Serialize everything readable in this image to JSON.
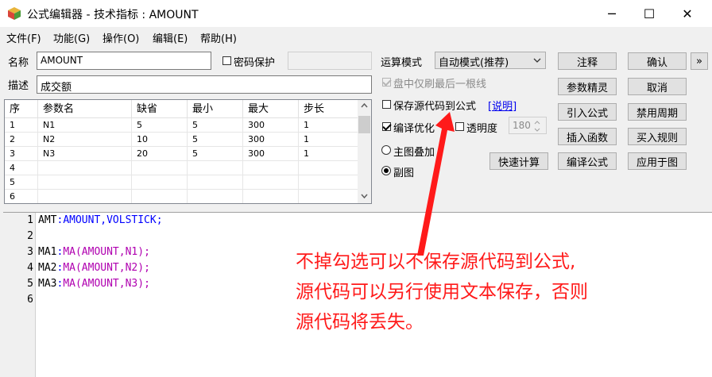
{
  "window": {
    "title": "公式编辑器 - 技术指标 : AMOUNT",
    "minimize": "─",
    "maximize": "☐",
    "close": "✕"
  },
  "menu": [
    "文件(F)",
    "功能(G)",
    "操作(O)",
    "编辑(E)",
    "帮助(H)"
  ],
  "form": {
    "name_label": "名称",
    "name_value": "AMOUNT",
    "password_label": "密码保护",
    "desc_label": "描述",
    "desc_value": "成交额"
  },
  "params": {
    "headers": [
      "序",
      "参数名",
      "缺省",
      "最小",
      "最大",
      "步长"
    ],
    "rows": [
      [
        "1",
        "N1",
        "5",
        "5",
        "300",
        "1"
      ],
      [
        "2",
        "N2",
        "10",
        "5",
        "300",
        "1"
      ],
      [
        "3",
        "N3",
        "20",
        "5",
        "300",
        "1"
      ],
      [
        "4",
        "",
        "",
        "",
        "",
        ""
      ],
      [
        "5",
        "",
        "",
        "",
        "",
        ""
      ],
      [
        "6",
        "",
        "",
        "",
        "",
        ""
      ]
    ]
  },
  "options": {
    "run_mode_label": "运算模式",
    "run_mode_value": "自动模式(推荐)",
    "last_bar_label": "盘中仅刷最后一根线",
    "save_source_label": "保存源代码到公式",
    "explain_link": "[说明]",
    "compile_opt_label": "编译优化",
    "transparency_label": "透明度",
    "transparency_value": "180",
    "main_overlay_label": "主图叠加",
    "sub_chart_label": "副图",
    "quick_calc": "快速计算"
  },
  "buttons": {
    "annotate": "注释",
    "confirm": "确认",
    "more": "»",
    "param_wizard": "参数精灵",
    "cancel": "取消",
    "import": "引入公式",
    "disable_period": "禁用周期",
    "insert_func": "插入函数",
    "buy_rule": "买入规则",
    "compile": "编译公式",
    "apply_chart": "应用于图"
  },
  "editor": {
    "lines": [
      {
        "n": "1",
        "name": "AMT",
        "sep": ":",
        "expr_kw": "AMOUNT,VOLSTICK",
        "fn": "",
        "end": ";"
      },
      {
        "n": "2",
        "name": "",
        "sep": "",
        "expr_kw": "",
        "fn": "",
        "end": ""
      },
      {
        "n": "3",
        "name": "MA1",
        "sep": ":",
        "expr_kw": "",
        "fn": "MA(AMOUNT,N1)",
        "end": ";"
      },
      {
        "n": "4",
        "name": "MA2",
        "sep": ":",
        "expr_kw": "",
        "fn": "MA(AMOUNT,N2)",
        "end": ";"
      },
      {
        "n": "5",
        "name": "MA3",
        "sep": ":",
        "expr_kw": "",
        "fn": "MA(AMOUNT,N3)",
        "end": ";"
      },
      {
        "n": "6",
        "name": "",
        "sep": "",
        "expr_kw": "",
        "fn": "",
        "end": ""
      }
    ]
  },
  "annotation": {
    "line1": "不掉勾选可以不保存源代码到公式,",
    "line2": "源代码可以另行使用文本保存，否则",
    "line3": "源代码将丢失。"
  },
  "colors": {
    "annotation": "#ff1a1a",
    "keyword": "#0000ff",
    "function": "#b000b0",
    "link": "#0000ee"
  }
}
